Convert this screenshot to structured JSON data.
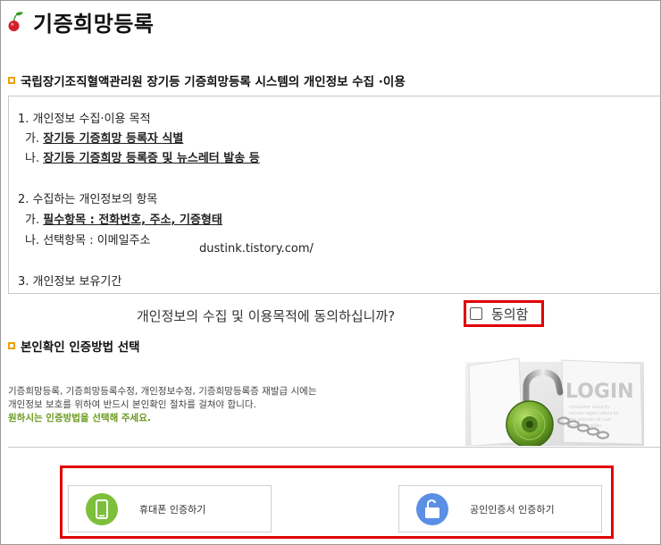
{
  "header": {
    "title": "기증희망등록"
  },
  "section1": {
    "heading": "국립장기조직혈액관리원 장기등 기증희망등록 시스템의 개인정보 수집 ·이용"
  },
  "terms": {
    "item1": {
      "title": "1. 개인정보 수집·이용 목적",
      "a_prefix": "가. ",
      "a_text": "장기등 기증희망 등록자 식별",
      "b_prefix": "나. ",
      "b_text": "장기등 기증희망 등록증 및 뉴스레터 발송 등"
    },
    "item2": {
      "title": "2. 수집하는 개인정보의 항목",
      "a_prefix": "가. ",
      "a_text": "필수항목 : 전화번호, 주소, 기증형태",
      "b_text": "나. 선택항목 : 이메일주소"
    },
    "item3": {
      "title": "3. 개인정보 보유기간"
    },
    "watermark": "dustink.tistory.com/"
  },
  "consent": {
    "question": "개인정보의 수집 및 이용목적에 동의하십니까?",
    "label": "동의함",
    "checked": false
  },
  "section2": {
    "heading": "본인확인 인증방법 선택",
    "desc_line1": "기증희망등록, 기증희망등록수정, 개인정보수정, 기증희망등록증 재발급 시에는",
    "desc_line2": "개인정보 보호를 위하여 반드시 본인확인 절차를 걸쳐야 합니다.",
    "desc_line3": "원하시는 인증방법을 선택해 주세요."
  },
  "login_image": {
    "text": "LOGIN",
    "small_text": "computer security\nsecure logon refers to\nthe process of user\nauthentication"
  },
  "auth": {
    "phone_label": "휴대폰 인증하기",
    "cert_label": "공인인증서 인증하기"
  },
  "colors": {
    "highlight": "#e00000",
    "bullet": "#f0a000",
    "green": "#6a9a1e",
    "phone_icon_bg": "#7dbf3a",
    "cert_icon_bg": "#5b8fe6"
  },
  "icons": [
    "cherry-logo-icon",
    "square-bullet-icon",
    "checkbox-icon",
    "padlock-image",
    "smartphone-icon",
    "unlock-icon"
  ]
}
